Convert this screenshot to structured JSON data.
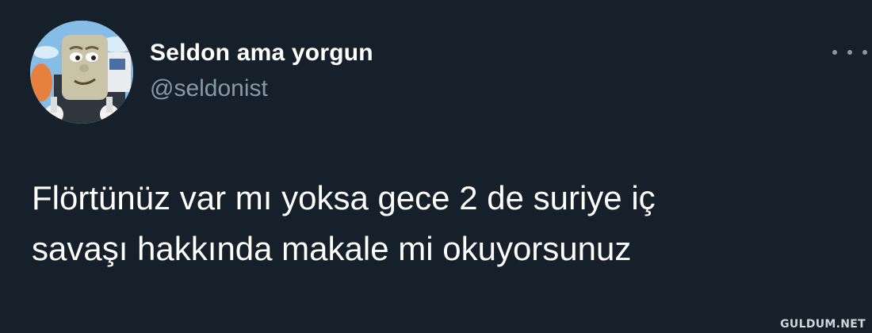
{
  "tweet": {
    "display_name": "Seldon ama yorgun",
    "handle": "@seldonist",
    "text_lines": [
      "Flörtünüz var mı yoksa gece 2 de suriye iç",
      "savaşı hakkında makale mi okuyorsunuz"
    ],
    "avatar_icon": "cartoon-train-avatar",
    "more_icon": "more-horizontal-icon"
  },
  "watermark": "GULDUM.NET",
  "colors": {
    "background": "#15202b",
    "text_primary": "#ffffff",
    "text_secondary": "#8899a6"
  }
}
